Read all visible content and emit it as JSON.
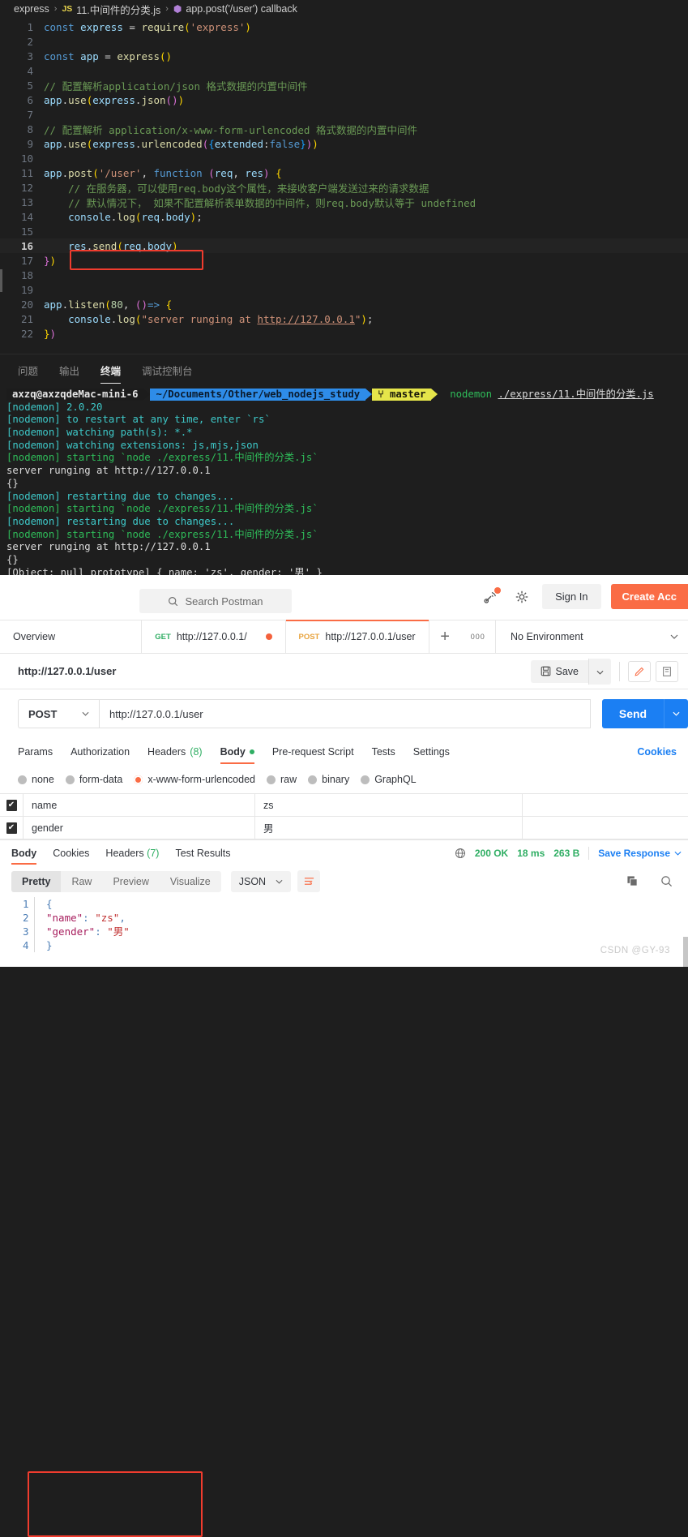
{
  "vscode": {
    "breadcrumb": {
      "root": "express",
      "file_badge": "JS",
      "file": "11.中间件的分类.js",
      "symbol": "app.post('/user') callback",
      "sep": "›"
    },
    "code_lines": [
      {
        "n": "1",
        "html": "<span class=\"kw\">const</span> <span class=\"var\">express</span> <span class=\"code\">=</span> <span class=\"fn\">require</span><span class=\"par\">(</span><span class=\"str\">'express'</span><span class=\"par\">)</span>"
      },
      {
        "n": "2",
        "html": ""
      },
      {
        "n": "3",
        "html": "<span class=\"kw\">const</span> <span class=\"var\">app</span> <span class=\"code\">=</span> <span class=\"fn\">express</span><span class=\"par\">()</span>"
      },
      {
        "n": "4",
        "html": ""
      },
      {
        "n": "5",
        "html": "<span class=\"cmt\">// 配置解析application/json 格式数据的内置中间件</span>"
      },
      {
        "n": "6",
        "html": "<span class=\"var\">app</span><span class=\"code\">.</span><span class=\"fn\">use</span><span class=\"par\">(</span><span class=\"var\">express</span><span class=\"code\">.</span><span class=\"fn\">json</span><span class=\"par2\">()</span><span class=\"par\">)</span>"
      },
      {
        "n": "7",
        "html": ""
      },
      {
        "n": "8",
        "html": "<span class=\"cmt\">// 配置解析 application/x-www-form-urlencoded 格式数据的内置中间件</span>"
      },
      {
        "n": "9",
        "html": "<span class=\"var\">app</span><span class=\"code\">.</span><span class=\"fn\">use</span><span class=\"par\">(</span><span class=\"var\">express</span><span class=\"code\">.</span><span class=\"fn\">urlencoded</span><span class=\"par2\">(</span><span class=\"par3\">{</span><span class=\"var\">extended</span><span class=\"code\">:</span><span class=\"kw\">false</span><span class=\"par3\">}</span><span class=\"par2\">)</span><span class=\"par\">)</span>"
      },
      {
        "n": "10",
        "html": ""
      },
      {
        "n": "11",
        "html": "<span class=\"var\">app</span><span class=\"code\">.</span><span class=\"fn\">post</span><span class=\"par\">(</span><span class=\"str\">'/user'</span><span class=\"code\">, </span><span class=\"kw\">function</span> <span class=\"par2\">(</span><span class=\"var\">req</span><span class=\"code\">, </span><span class=\"var\">res</span><span class=\"par2\">)</span> <span class=\"par\">{</span>"
      },
      {
        "n": "12",
        "html": "    <span class=\"cmt\">// 在服务器，可以使用req.body这个属性，来接收客户端发送过来的请求数据</span>"
      },
      {
        "n": "13",
        "html": "    <span class=\"cmt\">// 默认情况下， 如果不配置解析表单数据的中间件，则req.body默认等于 undefined</span>"
      },
      {
        "n": "14",
        "html": "    <span class=\"var\">console</span><span class=\"code\">.</span><span class=\"fn\">log</span><span class=\"par\">(</span><span class=\"var\">req</span><span class=\"code\">.</span><span class=\"var\">body</span><span class=\"par\">)</span><span class=\"code\">;</span>"
      },
      {
        "n": "15",
        "html": ""
      },
      {
        "n": "16",
        "html": "    <span class=\"var\">res</span><span class=\"code\">.</span><span class=\"fn\">send</span><span class=\"par\">(</span><span class=\"var\">req</span><span class=\"code\">.</span><span class=\"var\">body</span><span class=\"par\">)</span>",
        "current": true
      },
      {
        "n": "17",
        "html": "<span class=\"par2\">}</span><span class=\"par\">)</span>"
      },
      {
        "n": "18",
        "html": ""
      },
      {
        "n": "19",
        "html": ""
      },
      {
        "n": "20",
        "html": "<span class=\"var\">app</span><span class=\"code\">.</span><span class=\"fn\">listen</span><span class=\"par\">(</span><span class=\"num\">80</span><span class=\"code\">, </span><span class=\"par2\">()</span><span class=\"kw\">=&gt;</span> <span class=\"par\">{</span>"
      },
      {
        "n": "21",
        "html": "    <span class=\"var\">console</span><span class=\"code\">.</span><span class=\"fn\">log</span><span class=\"par\">(</span><span class=\"str\">\"server runging at </span><span class=\"link\">http://127.0.0.1</span><span class=\"str\">\"</span><span class=\"par\">)</span><span class=\"code\">;</span>"
      },
      {
        "n": "22",
        "html": "<span class=\"par\">}</span><span class=\"par2\">)</span>"
      }
    ],
    "panel_tabs": [
      {
        "label": "问题",
        "active": false
      },
      {
        "label": "输出",
        "active": false
      },
      {
        "label": "终端",
        "active": true
      },
      {
        "label": "调试控制台",
        "active": false
      }
    ],
    "terminal": {
      "prompt": {
        "user": "axzq@axzqdeMac-mini-6",
        "path": "~/Documents/Other/web_nodejs_study",
        "git": "⑂ master",
        "cmd_name": "nodemon",
        "cmd_arg": "./express/11.中间件的分类.js"
      },
      "lines": [
        {
          "text": "[nodemon] 2.0.20",
          "cls": "t-cyan"
        },
        {
          "text": "[nodemon] to restart at any time, enter `rs`",
          "cls": "t-cyan"
        },
        {
          "text": "[nodemon] watching path(s): *.*",
          "cls": "t-cyan"
        },
        {
          "text": "[nodemon] watching extensions: js,mjs,json",
          "cls": "t-cyan"
        },
        {
          "text": "[nodemon] starting `node ./express/11.中间件的分类.js`",
          "cls": "t-green"
        },
        {
          "text": "server runging at http://127.0.0.1",
          "cls": "t-white"
        },
        {
          "text": "{}",
          "cls": "t-white"
        },
        {
          "text": "[nodemon] restarting due to changes...",
          "cls": "t-cyan"
        },
        {
          "text": "[nodemon] starting `node ./express/11.中间件的分类.js`",
          "cls": "t-green"
        },
        {
          "text": "[nodemon] restarting due to changes...",
          "cls": "t-cyan"
        },
        {
          "text": "[nodemon] starting `node ./express/11.中间件的分类.js`",
          "cls": "t-green"
        },
        {
          "text": "server runging at http://127.0.0.1",
          "cls": "t-white"
        },
        {
          "text": "{}",
          "cls": "t-white"
        },
        {
          "text": "[Object: null prototype] { name: 'zs', gender: '男' }",
          "cls": "t-white"
        }
      ]
    }
  },
  "postman": {
    "search_placeholder": "Search Postman",
    "sign_in": "Sign In",
    "create_account": "Create Acc",
    "tabs": [
      {
        "label": "Overview",
        "method": "",
        "active": false,
        "unsaved": false
      },
      {
        "label": "http://127.0.0.1/",
        "method": "GET",
        "active": false,
        "unsaved": true
      },
      {
        "label": "http://127.0.0.1/user",
        "method": "POST",
        "active": true,
        "unsaved": true
      }
    ],
    "tab_add": "+",
    "tab_more": "000",
    "environment": "No Environment",
    "request_title": "http://127.0.0.1/user",
    "save_label": "Save",
    "method": "POST",
    "url": "http://127.0.0.1/user",
    "send_label": "Send",
    "req_tabs": [
      {
        "label": "Params",
        "active": false
      },
      {
        "label": "Authorization",
        "active": false
      },
      {
        "label": "Headers",
        "count": "(8)",
        "active": false
      },
      {
        "label": "Body",
        "dot": true,
        "active": true
      },
      {
        "label": "Pre-request Script",
        "active": false
      },
      {
        "label": "Tests",
        "active": false
      },
      {
        "label": "Settings",
        "active": false
      }
    ],
    "cookies_link": "Cookies",
    "body_types": [
      {
        "label": "none",
        "selected": false
      },
      {
        "label": "form-data",
        "selected": false
      },
      {
        "label": "x-www-form-urlencoded",
        "selected": true
      },
      {
        "label": "raw",
        "selected": false
      },
      {
        "label": "binary",
        "selected": false
      },
      {
        "label": "GraphQL",
        "selected": false
      }
    ],
    "body_rows": [
      {
        "checked": true,
        "key": "name",
        "value": "zs",
        "desc": ""
      },
      {
        "checked": true,
        "key": "gender",
        "value": "男",
        "desc": ""
      }
    ],
    "resp_tabs": [
      {
        "label": "Body",
        "active": true
      },
      {
        "label": "Cookies",
        "active": false
      },
      {
        "label": "Headers",
        "count": "(7)",
        "active": false
      },
      {
        "label": "Test Results",
        "active": false
      }
    ],
    "resp_status": "200 OK",
    "resp_time": "18 ms",
    "resp_size": "263 B",
    "save_response": "Save Response",
    "view_tabs": [
      "Pretty",
      "Raw",
      "Preview",
      "Visualize"
    ],
    "format": "JSON",
    "json_lines": [
      {
        "n": "1",
        "html": "<span class=\"jbr\">{</span>"
      },
      {
        "n": "2",
        "html": "    <span class=\"jkey\">\"name\"</span><span class=\"jbr\">:</span> <span class=\"jstr\">\"zs\"</span><span class=\"jbr\">,</span>"
      },
      {
        "n": "3",
        "html": "    <span class=\"jkey\">\"gender\"</span><span class=\"jbr\">:</span> <span class=\"jstr\">\"男\"</span>"
      },
      {
        "n": "4",
        "html": "<span class=\"jbr\">}</span>"
      }
    ],
    "watermark": "CSDN @GY-93"
  }
}
